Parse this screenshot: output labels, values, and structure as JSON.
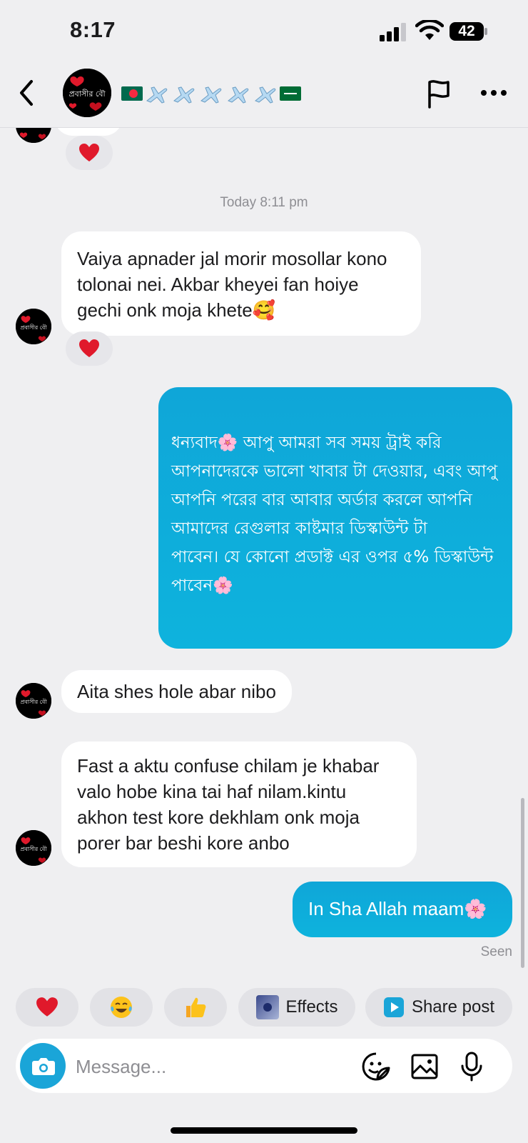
{
  "status_bar": {
    "time": "8:17",
    "battery": "42"
  },
  "header": {
    "avatar_text": "প্রবাসীর বৌ"
  },
  "chat": {
    "timestamp": "Today 8:11 pm",
    "messages": [
      {
        "text": "Vaiya apnader jal morir mosollar kono tolonai nei. Akbar kheyei fan hoiye gechi onk moja khete🥰"
      },
      {
        "text": "ধন্যবাদ🌸 আপু আমরা সব সময় ট্রাই করি আপনাদেরকে ভালো খাবার টা দেওয়ার, এবং আপু আপনি পরের বার আবার অর্ডার করলে আপনি আমাদের রেগুলার কাষ্টমার ডিস্কাউন্ট টা\nপাবেন। যে কোনো প্রডাক্ট এর ওপর ৫% ডিস্কাউন্ট\nপাবেন🌸"
      },
      {
        "text": "Aita shes hole abar nibo"
      },
      {
        "text": "Fast a aktu confuse chilam je khabar valo hobe kina tai haf nilam.kintu akhon test kore dekhlam onk moja porer bar beshi kore anbo"
      },
      {
        "text": "In Sha Allah maam🌸"
      }
    ],
    "seen_label": "Seen"
  },
  "quick_reactions": {
    "effects_label": "Effects",
    "share_label": "Share post"
  },
  "composer": {
    "placeholder": "Message..."
  },
  "colors": {
    "accent": "#1aa5d8",
    "outgoing_bubble": "#0fa6d8",
    "background": "#efeff1",
    "heart": "#e0192b"
  }
}
